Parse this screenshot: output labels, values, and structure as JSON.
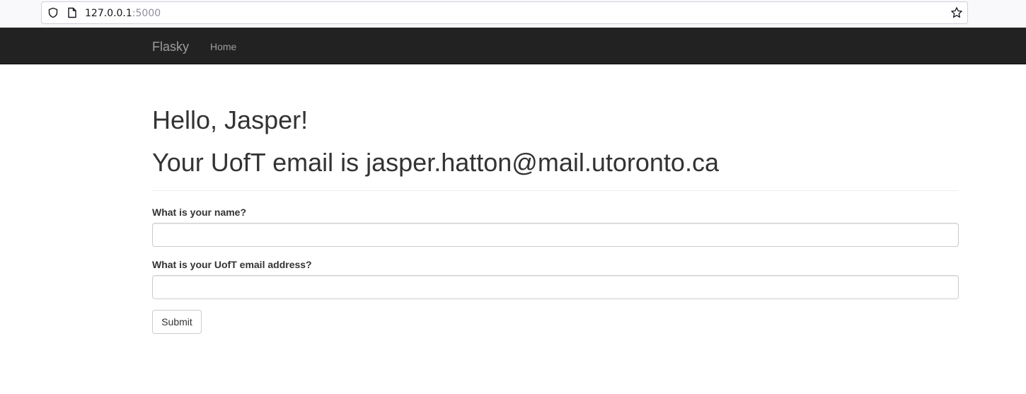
{
  "browser": {
    "url_host": "127.0.0.1",
    "url_port": ":5000",
    "icons": [
      "shield-icon",
      "page-icon",
      "star-icon"
    ]
  },
  "navbar": {
    "brand": "Flasky",
    "links": [
      {
        "label": "Home"
      }
    ]
  },
  "main": {
    "greeting": "Hello, Jasper!",
    "email_line": "Your UofT email is jasper.hatton@mail.utoronto.ca",
    "form": {
      "name_label": "What is your name?",
      "name_value": "",
      "email_label": "What is your UofT email address?",
      "email_value": "",
      "submit_label": "Submit"
    }
  },
  "colors": {
    "navbar_bg": "#222222",
    "navbar_text": "#9d9d9d",
    "heading_text": "#333333"
  }
}
